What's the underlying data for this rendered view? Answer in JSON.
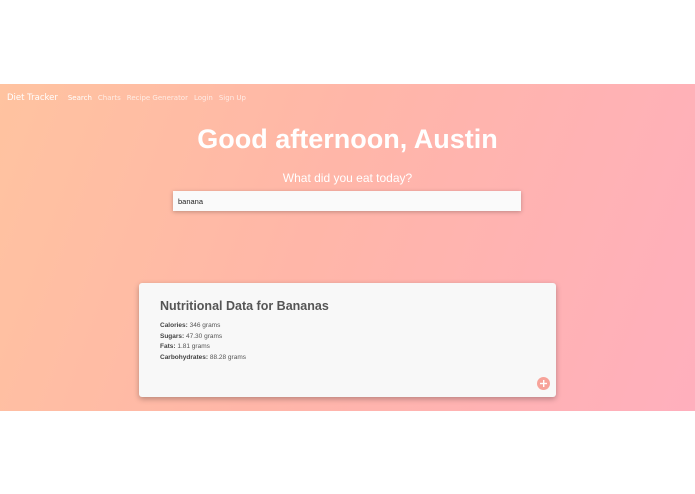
{
  "nav": {
    "brand": "Diet Tracker",
    "links": [
      "Search",
      "Charts",
      "Recipe Generator",
      "Login",
      "Sign Up"
    ],
    "active": "Search"
  },
  "hero": {
    "greeting": "Good afternoon, Austin",
    "prompt": "What did you eat today?"
  },
  "search": {
    "value": "banana"
  },
  "card": {
    "title": "Nutritional Data for Bananas",
    "nutrients": [
      {
        "label": "Calories:",
        "value": "346 grams"
      },
      {
        "label": "Sugars:",
        "value": "47.30 grams"
      },
      {
        "label": "Fats:",
        "value": "1.81 grams"
      },
      {
        "label": "Carbohydrates:",
        "value": "88.28 grams"
      }
    ],
    "add_icon": "plus-circle-icon"
  },
  "colors": {
    "gradient_start": "#ffc3a0",
    "gradient_end": "#ffafbd",
    "add_button": "#f7a39a"
  }
}
